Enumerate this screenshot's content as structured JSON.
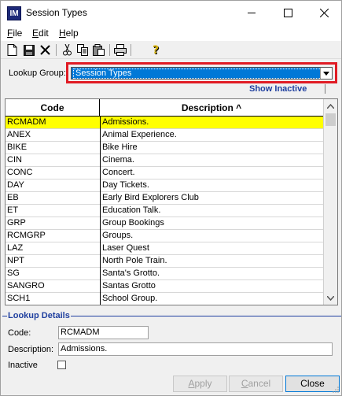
{
  "window": {
    "title": "Session Types",
    "app_icon": "IM"
  },
  "menu": [
    {
      "label": "File",
      "accel": "F",
      "rest": "ile"
    },
    {
      "label": "Edit",
      "accel": "E",
      "rest": "dit"
    },
    {
      "label": "Help",
      "accel": "H",
      "rest": "elp"
    }
  ],
  "toolbar": [
    "new-document-icon",
    "save-icon",
    "delete-icon",
    "cut-icon",
    "copy-icon",
    "paste-icon",
    "print-icon",
    "help-icon"
  ],
  "lookup": {
    "label": "Lookup Group:",
    "selected": "Session Types",
    "highlight_color": "#e01b24"
  },
  "show_inactive": {
    "label": "Show Inactive",
    "checked": false
  },
  "grid": {
    "columns": {
      "code": "Code",
      "description": "Description",
      "sort_indicator": "^"
    },
    "rows": [
      {
        "code": "RCMADM",
        "description": "Admissions.",
        "selected": true
      },
      {
        "code": "ANEX",
        "description": "Animal Experience."
      },
      {
        "code": "BIKE",
        "description": "Bike Hire"
      },
      {
        "code": "CIN",
        "description": "Cinema."
      },
      {
        "code": "CONC",
        "description": "Concert."
      },
      {
        "code": "DAY",
        "description": "Day Tickets."
      },
      {
        "code": "EB",
        "description": "Early Bird Explorers Club"
      },
      {
        "code": "ET",
        "description": "Education Talk."
      },
      {
        "code": "GRP",
        "description": "Group Bookings"
      },
      {
        "code": "RCMGRP",
        "description": "Groups."
      },
      {
        "code": "LAZ",
        "description": "Laser Quest"
      },
      {
        "code": "NPT",
        "description": "North Pole Train."
      },
      {
        "code": "SG",
        "description": "Santa's Grotto."
      },
      {
        "code": "SANGRO",
        "description": "Santas Grotto"
      },
      {
        "code": "SCH1",
        "description": "School Group."
      }
    ],
    "selected_color": "#ffff00"
  },
  "details": {
    "legend": "Lookup Details",
    "code_label": "Code:",
    "code_value": "RCMADM",
    "description_label": "Description:",
    "description_value": "Admissions.",
    "inactive_label": "Inactive",
    "inactive_checked": false
  },
  "buttons": {
    "apply": {
      "accel": "A",
      "rest": "pply",
      "enabled": false
    },
    "cancel": {
      "accel": "C",
      "rest": "ancel",
      "enabled": false
    },
    "close": {
      "label": "Close",
      "enabled": true
    }
  }
}
